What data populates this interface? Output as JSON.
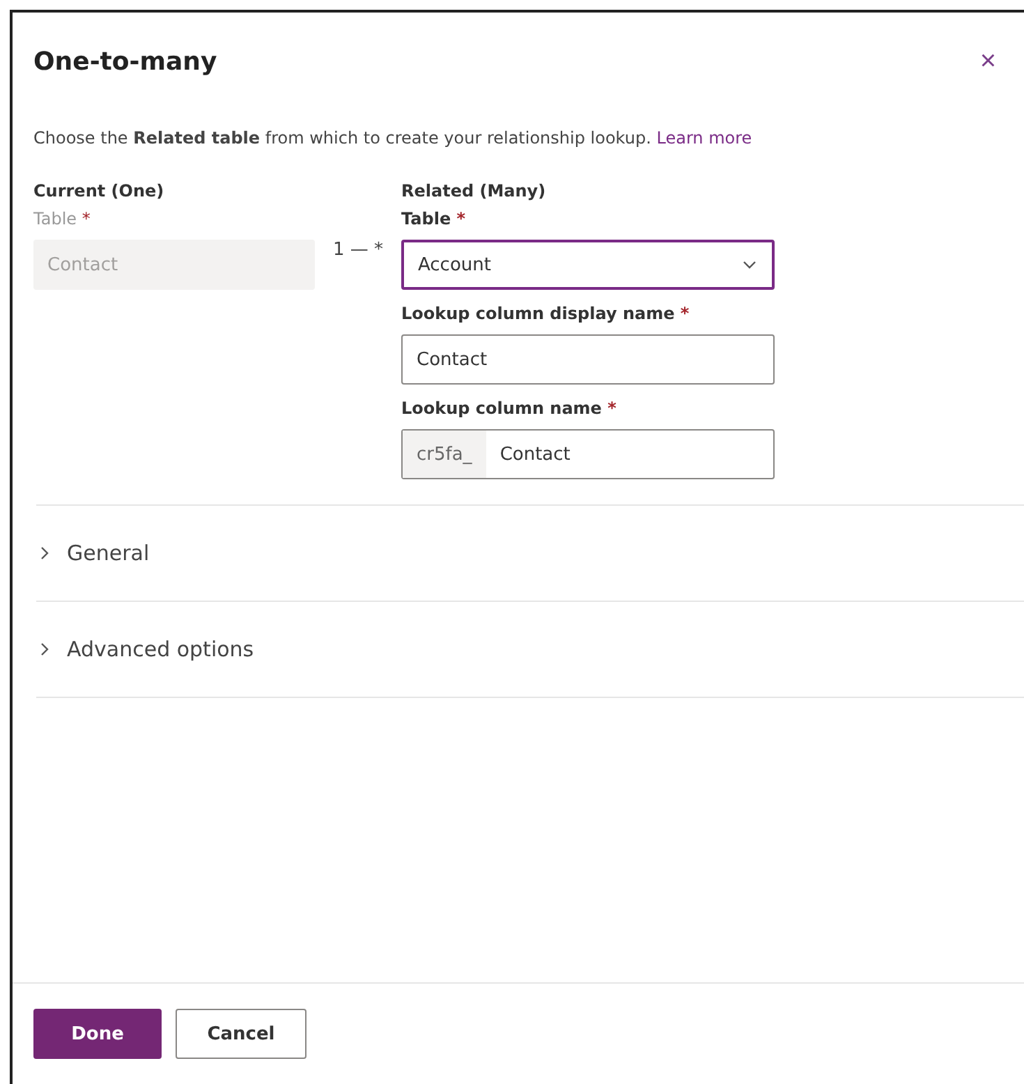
{
  "dialog": {
    "title": "One-to-many",
    "close": "×"
  },
  "description": {
    "text": "Choose the **Related table** from which to create your relationship lookup.",
    "link": "Learn more"
  },
  "current": {
    "heading": "Current (One)",
    "label": "Table",
    "required": "*",
    "value": "Contact",
    "disabled": true
  },
  "connector": "1 — *",
  "related": {
    "heading": "Related (Many)",
    "fields": [
      {
        "kind": "select",
        "label": "Table",
        "required": "*",
        "value": "Account",
        "focused": true
      },
      {
        "kind": "text",
        "label": "Lookup column display name",
        "required": "*",
        "value": "Contact",
        "focused": false
      },
      {
        "kind": "prefixed",
        "label": "Lookup column name",
        "required": "*",
        "prefix": "cr5fa_",
        "value": "Contact",
        "focused": false
      }
    ]
  },
  "sections": [
    {
      "label": "General",
      "expanded": false
    },
    {
      "label": "Advanced options",
      "expanded": false
    }
  ],
  "buttons": [
    {
      "label": "Done",
      "kind": "primary"
    },
    {
      "label": "Cancel",
      "kind": "secondary"
    }
  ]
}
